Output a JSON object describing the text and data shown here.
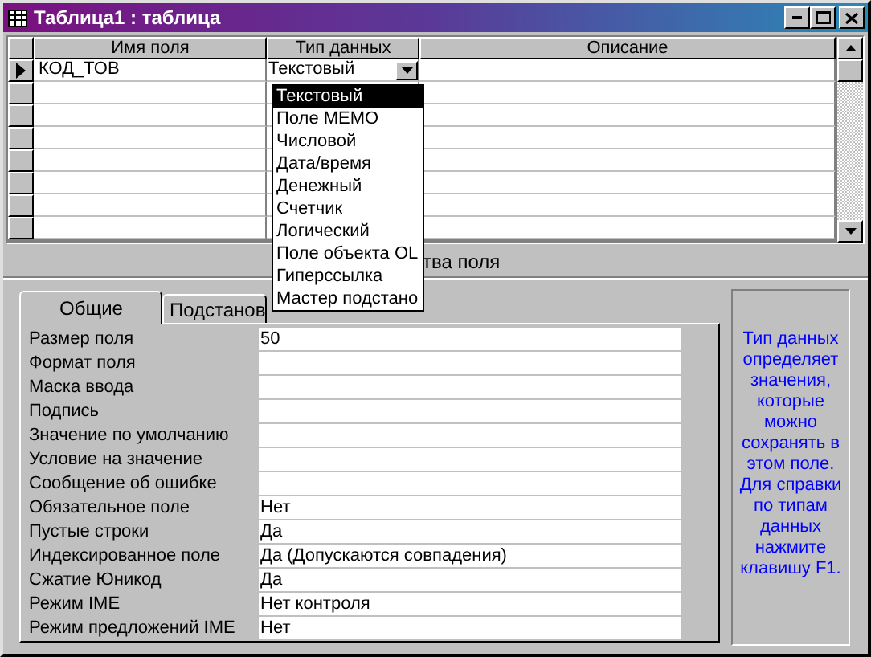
{
  "window": {
    "title": "Таблица1 : таблица"
  },
  "table": {
    "columns": [
      "Имя поля",
      "Тип данных",
      "Описание"
    ],
    "rows": [
      {
        "field_name": "КОД_ТОВ",
        "data_type": "Текстовый",
        "current": true
      }
    ]
  },
  "type_dropdown": {
    "items": [
      {
        "label": "Текстовый",
        "selected": true
      },
      {
        "label": "Поле MEMO",
        "selected": false
      },
      {
        "label": "Числовой",
        "selected": false
      },
      {
        "label": "Дата/время",
        "selected": false
      },
      {
        "label": "Денежный",
        "selected": false
      },
      {
        "label": "Счетчик",
        "selected": false
      },
      {
        "label": "Логический",
        "selected": false
      },
      {
        "label": "Поле объекта OL",
        "selected": false
      },
      {
        "label": "Гиперссылка",
        "selected": false
      },
      {
        "label": "Мастер подстано",
        "selected": false
      }
    ]
  },
  "section_label": "тва поля",
  "tabs": [
    {
      "label": "Общие",
      "selected": true
    },
    {
      "label": "Подстанов",
      "selected": false
    }
  ],
  "properties": [
    {
      "label": "Размер поля",
      "value": "50"
    },
    {
      "label": "Формат поля"
    },
    {
      "label": "Маска ввода"
    },
    {
      "label": "Подпись"
    },
    {
      "label": "Значение по умолчанию"
    },
    {
      "label": "Условие на значение"
    },
    {
      "label": "Сообщение об ошибке"
    },
    {
      "label": "Обязательное поле",
      "value": "Нет"
    },
    {
      "label": "Пустые строки",
      "value": "Да"
    },
    {
      "label": "Индексированное поле",
      "value": "Да (Допускаются совпадения)"
    },
    {
      "label": "Сжатие Юникод",
      "value": "Да"
    },
    {
      "label": "Режим IME",
      "value": "Нет контроля"
    },
    {
      "label": "Режим предложений IME",
      "value": "Нет"
    }
  ],
  "help_text": "Тип данных определяет значения, которые можно сохранять в этом поле.  Для справки по типам данных нажмите клавишу F1."
}
